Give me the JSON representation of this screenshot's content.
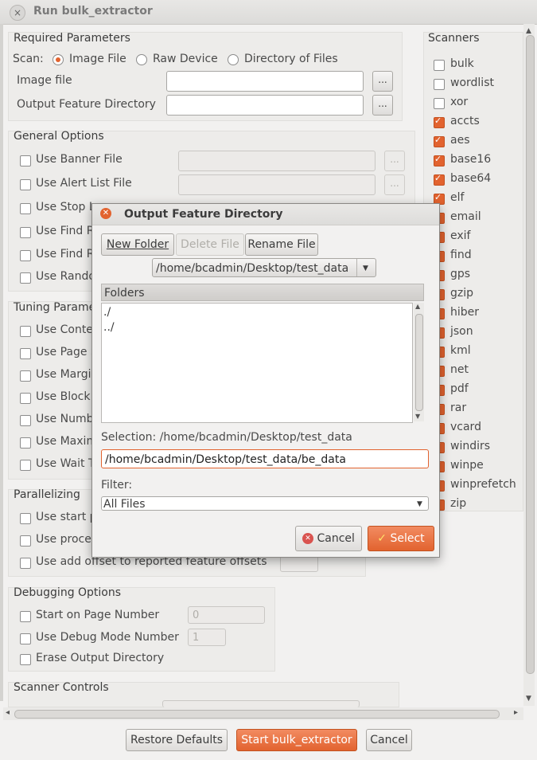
{
  "window": {
    "title": "Run bulk_extractor",
    "close": "×"
  },
  "required": {
    "title": "Required Parameters",
    "scan_label": "Scan:",
    "scan_options": [
      "Image File",
      "Raw Device",
      "Directory of Files"
    ],
    "image_file_label": "Image file",
    "output_dir_label": "Output Feature Directory",
    "browse": "..."
  },
  "general": {
    "title": "General Options",
    "items": [
      "Use Banner File",
      "Use Alert List File",
      "Use Stop L",
      "Use Find R",
      "Use Find R",
      "Use Rando"
    ]
  },
  "tuning": {
    "title": "Tuning Parame",
    "items": [
      "Use Conte",
      "Use Page S",
      "Use Margir",
      "Use Block",
      "Use Numb",
      "Use Maxim",
      "Use Wait T"
    ]
  },
  "parallel": {
    "title": "Parallelizing",
    "items": [
      "Use start p",
      "Use proce",
      "Use add offset to reported feature offsets"
    ]
  },
  "debug": {
    "title": "Debugging Options",
    "items": [
      "Start on Page Number",
      "Use Debug Mode Number",
      "Erase Output Directory"
    ],
    "page_number_value": "0",
    "debug_mode_value": "1"
  },
  "scanner_controls": {
    "title": "Scanner Controls"
  },
  "scanners": {
    "title": "Scanners",
    "items": [
      {
        "name": "bulk",
        "checked": false
      },
      {
        "name": "wordlist",
        "checked": false
      },
      {
        "name": "xor",
        "checked": false
      },
      {
        "name": "accts",
        "checked": true
      },
      {
        "name": "aes",
        "checked": true
      },
      {
        "name": "base16",
        "checked": true
      },
      {
        "name": "base64",
        "checked": true
      },
      {
        "name": "elf",
        "checked": true
      },
      {
        "name": "email",
        "checked": true
      },
      {
        "name": "exif",
        "checked": true
      },
      {
        "name": "find",
        "checked": true
      },
      {
        "name": "gps",
        "checked": true
      },
      {
        "name": "gzip",
        "checked": true
      },
      {
        "name": "hiber",
        "checked": true
      },
      {
        "name": "json",
        "checked": true
      },
      {
        "name": "kml",
        "checked": true
      },
      {
        "name": "net",
        "checked": true
      },
      {
        "name": "pdf",
        "checked": true
      },
      {
        "name": "rar",
        "checked": true
      },
      {
        "name": "vcard",
        "checked": true
      },
      {
        "name": "windirs",
        "checked": true
      },
      {
        "name": "winpe",
        "checked": true
      },
      {
        "name": "winprefetch",
        "checked": true
      },
      {
        "name": "zip",
        "checked": true
      }
    ]
  },
  "bottom": {
    "restore": "Restore Defaults",
    "start": "Start bulk_extractor",
    "cancel": "Cancel"
  },
  "dialog": {
    "title": "Output Feature Directory",
    "new_folder": "New Folder",
    "delete_file": "Delete File",
    "rename_file": "Rename File",
    "path_combo": "/home/bcadmin/Desktop/test_data",
    "folders_header": "Folders",
    "folders": [
      "./",
      "../"
    ],
    "selection_label": "Selection: /home/bcadmin/Desktop/test_data",
    "selection_value": "/home/bcadmin/Desktop/test_data/be_data",
    "filter_label": "Filter:",
    "filter_value": "All Files",
    "cancel": "Cancel",
    "select": "Select"
  },
  "colors": {
    "accent": "#e2632f",
    "bg": "#f2f1f0"
  }
}
